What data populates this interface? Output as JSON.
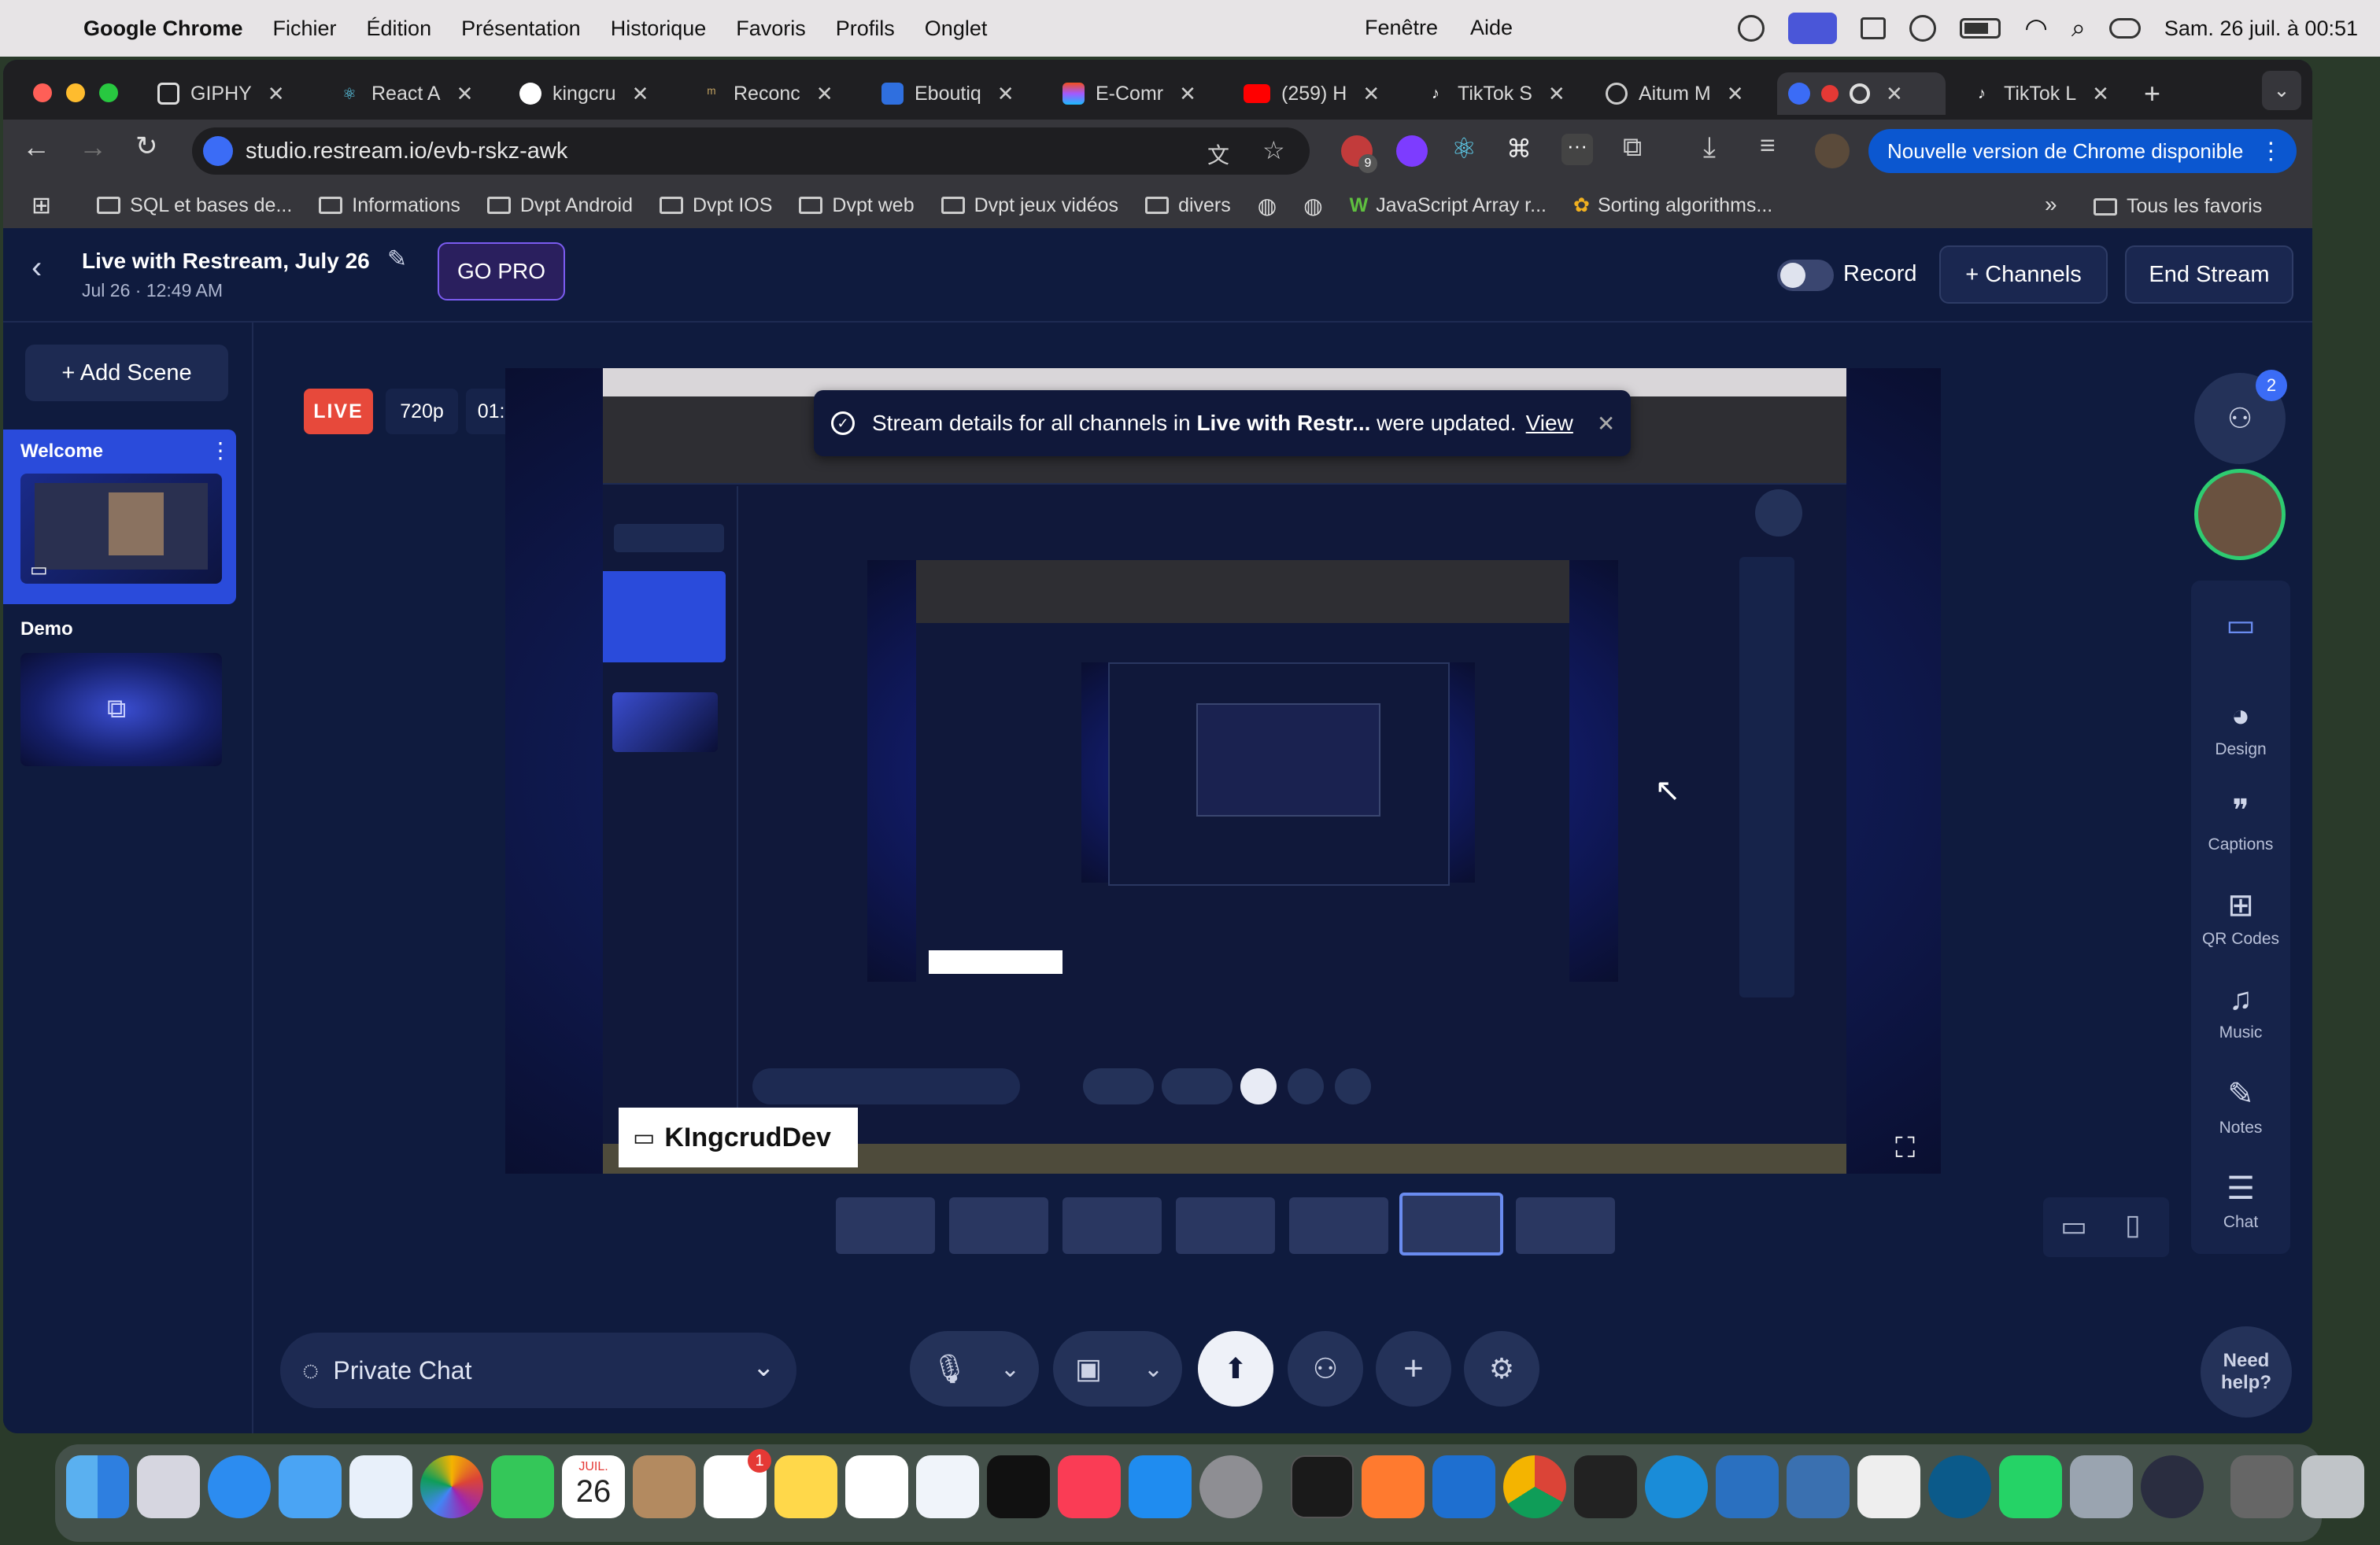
{
  "menubar": {
    "apple": "",
    "app": "Google Chrome",
    "items": [
      "Fichier",
      "Édition",
      "Présentation",
      "Historique",
      "Favoris",
      "Profils",
      "Onglet"
    ],
    "items_right": [
      "Fenêtre",
      "Aide"
    ],
    "datetime": "Sam. 26 juil. à 00:51"
  },
  "tabs": [
    {
      "label": "GIPHY",
      "icon": "giphy-icon",
      "color": "#f1f1f1"
    },
    {
      "label": "React A",
      "icon": "react-icon",
      "color": "#61dafb"
    },
    {
      "label": "kingcru",
      "icon": "github-icon",
      "color": "#ffffff"
    },
    {
      "label": "Reconc",
      "icon": "reconcile-icon",
      "color": "#c0a060"
    },
    {
      "label": "Eboutiq",
      "icon": "eboutique-icon",
      "color": "#2f6fdf"
    },
    {
      "label": "E-Comr",
      "icon": "figma-icon",
      "color": "#f24e1e"
    },
    {
      "label": "(259) H",
      "icon": "youtube-icon",
      "color": "#ff0000"
    },
    {
      "label": "TikTok S",
      "icon": "tiktok-icon",
      "color": "#ffffff"
    },
    {
      "label": "Aitum M",
      "icon": "aitum-icon",
      "color": "#cccccc"
    },
    {
      "label": "",
      "icon": "restream-icon",
      "color": "#3b6cf6"
    },
    {
      "label": "TikTok L",
      "icon": "tiktok-icon",
      "color": "#ffffff"
    }
  ],
  "omnibox": {
    "url": "studio.restream.io/evb-rskz-awk",
    "ext_badge": "9"
  },
  "update_pill": "Nouvelle version de Chrome disponible",
  "bookmarks": [
    "SQL et bases de...",
    "Informations",
    "Dvpt Android",
    "Dvpt IOS",
    "Dvpt web",
    "Dvpt jeux vidéos",
    "divers",
    "JavaScript Array r...",
    "Sorting algorithms..."
  ],
  "bookmarks_right": "Tous les favoris",
  "header": {
    "title": "Live with Restream, July 26",
    "subtitle": "Jul 26 · 12:49 AM",
    "gopro": "GO PRO",
    "record": "Record",
    "channels": "+ Channels",
    "end": "End Stream"
  },
  "scenes": {
    "add": "+ Add Scene",
    "items": [
      {
        "label": "Welcome"
      },
      {
        "label": "Demo"
      }
    ]
  },
  "stage": {
    "live": "LIVE",
    "quality": "720p",
    "timer": "01:48",
    "banner_prefix": "Stream details for all channels in ",
    "banner_bold": "Live with Restr...",
    "banner_suffix": " were updated.",
    "banner_link": "View",
    "nametag": "KIngcrudDev"
  },
  "bottom": {
    "chat": "Private Chat",
    "help": "Need help?"
  },
  "rightbar": {
    "guest_count": "2",
    "tools": [
      "Design",
      "Captions",
      "QR Codes",
      "Music",
      "Notes",
      "Chat"
    ]
  },
  "dock": {
    "calendar_month": "JUIL.",
    "calendar_day": "26",
    "badge": "1"
  }
}
